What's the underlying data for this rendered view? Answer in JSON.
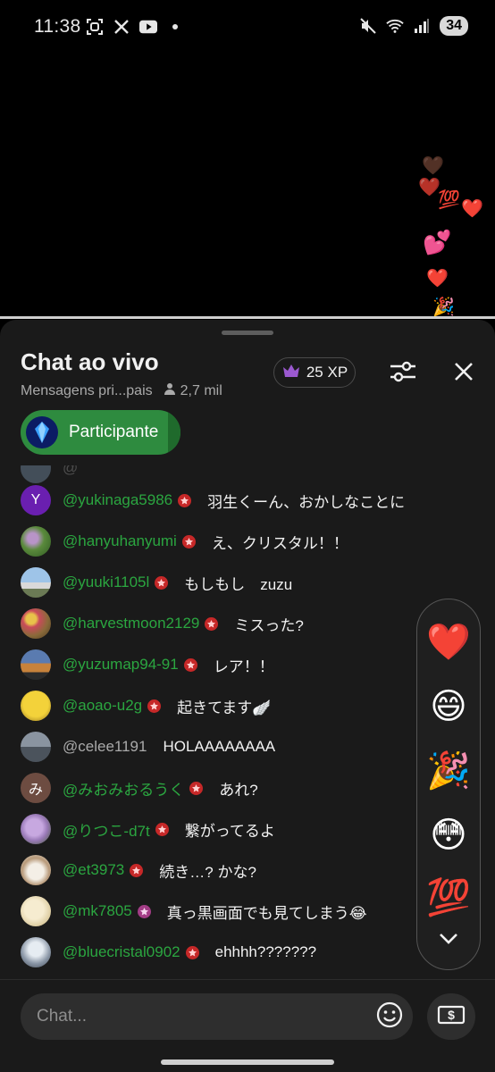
{
  "status_bar": {
    "time": "11:38",
    "battery": "34",
    "left_icons": [
      "screenshot-icon",
      "x-icon",
      "youtube-icon",
      "dot-icon"
    ],
    "right_icons": [
      "mute-icon",
      "wifi-icon",
      "signal-icon"
    ]
  },
  "video": {
    "floating_reactions": [
      "🤎",
      "❤️",
      "💯",
      "❤️",
      "💕",
      "❤️",
      "🎉"
    ]
  },
  "chat": {
    "title": "Chat ao vivo",
    "subtitle": "Mensagens pri...pais",
    "viewer_count": "2,7 mil",
    "xp": "25 XP",
    "participant_label": "Participante",
    "input_placeholder": "Chat..."
  },
  "messages": [
    {
      "avatar_letter": "Y",
      "avatar_color": "#6a1fb0",
      "author": "@yukinaga5986",
      "badge": "red",
      "text": "羽生くーん、おかしなことに"
    },
    {
      "avatar_letter": "",
      "avatar_color": "#5a8a3c",
      "author": "@hanyuhanyumi",
      "badge": "red",
      "text": "え、クリスタル！！"
    },
    {
      "avatar_letter": "",
      "avatar_color": "#7fa3c8",
      "author": "@yuuki1105l",
      "badge": "red",
      "text": "もしもし　zuzu"
    },
    {
      "avatar_letter": "",
      "avatar_color": "#8a6a3a",
      "author": "@harvestmoon2129",
      "badge": "red",
      "text": "ミスった?"
    },
    {
      "avatar_letter": "",
      "avatar_color": "#c7823b",
      "author": "@yuzumap94-91",
      "badge": "red",
      "text": "レア！！"
    },
    {
      "avatar_letter": "",
      "avatar_color": "#e5c12a",
      "author": "@aoao-u2g",
      "badge": "red",
      "text": "起きてます🪽"
    },
    {
      "avatar_letter": "",
      "avatar_color": "#5b6470",
      "author": "@celee1191",
      "badge": "none",
      "text": "HOLAAAAAAAA"
    },
    {
      "avatar_letter": "み",
      "avatar_color": "#6d4c41",
      "author": "@みおみおるうく",
      "badge": "red",
      "text": "あれ?"
    },
    {
      "avatar_letter": "",
      "avatar_color": "#9a7ab8",
      "author": "@りつこ-d7t",
      "badge": "red",
      "text": "繋がってるよ"
    },
    {
      "avatar_letter": "",
      "avatar_color": "#d8d2c6",
      "author": "@et3973",
      "badge": "red",
      "text": "続き…? かな?"
    },
    {
      "avatar_letter": "",
      "avatar_color": "#e9dcb8",
      "author": "@mk7805",
      "badge": "purple",
      "text": "真っ黒画面でも見てしまう😂"
    },
    {
      "avatar_letter": "",
      "avatar_color": "#8a96a6",
      "author": "@bluecristal0902",
      "badge": "red",
      "text": "ehhhh???????"
    }
  ],
  "reactions": [
    "❤️",
    "😄",
    "🎉",
    "😳",
    "💯"
  ],
  "icons": {
    "crown": "crown-icon",
    "filter": "filter-sliders-icon",
    "close": "close-icon",
    "person": "person-icon",
    "emoji": "emoji-icon",
    "superchat": "superchat-dollar-icon",
    "collapse": "chevron-down-icon"
  }
}
